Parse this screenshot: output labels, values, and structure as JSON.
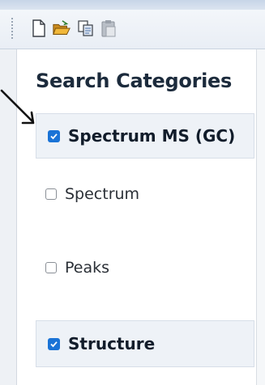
{
  "toolbar": {
    "icons": [
      "new-document-icon",
      "open-folder-icon",
      "copy-icon",
      "paste-icon"
    ]
  },
  "panel": {
    "title": "Search Categories",
    "categories": [
      {
        "label": "Spectrum MS (GC)",
        "checked": true,
        "options": [
          {
            "label": "Spectrum",
            "checked": false
          },
          {
            "label": "Peaks",
            "checked": false
          }
        ]
      },
      {
        "label": "Structure",
        "checked": true
      }
    ]
  },
  "colors": {
    "accent": "#1a73d6",
    "header_bg": "#eef2f7",
    "title_text": "#1c2b3c"
  }
}
